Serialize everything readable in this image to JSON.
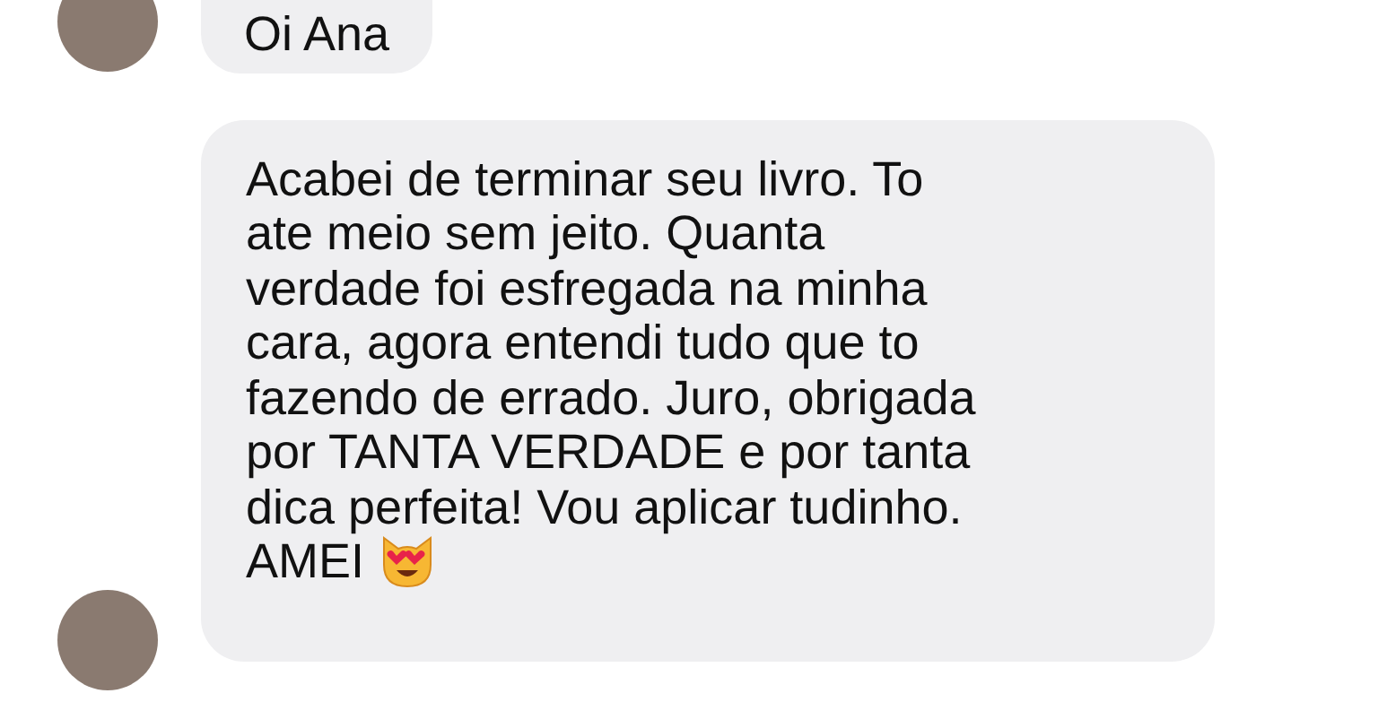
{
  "messages": [
    {
      "lines": [
        "Oi Ana"
      ],
      "emoji": false
    },
    {
      "lines": [
        "Acabei de terminar seu livro. To",
        "ate meio sem jeito. Quanta",
        "verdade foi esfregada na minha",
        "cara, agora entendi tudo que to",
        "fazendo de errado. Juro, obrigada",
        "por TANTA VERDADE e por tanta",
        "dica perfeita! Vou aplicar tudinho.",
        "AMEI"
      ],
      "emoji": true
    }
  ]
}
